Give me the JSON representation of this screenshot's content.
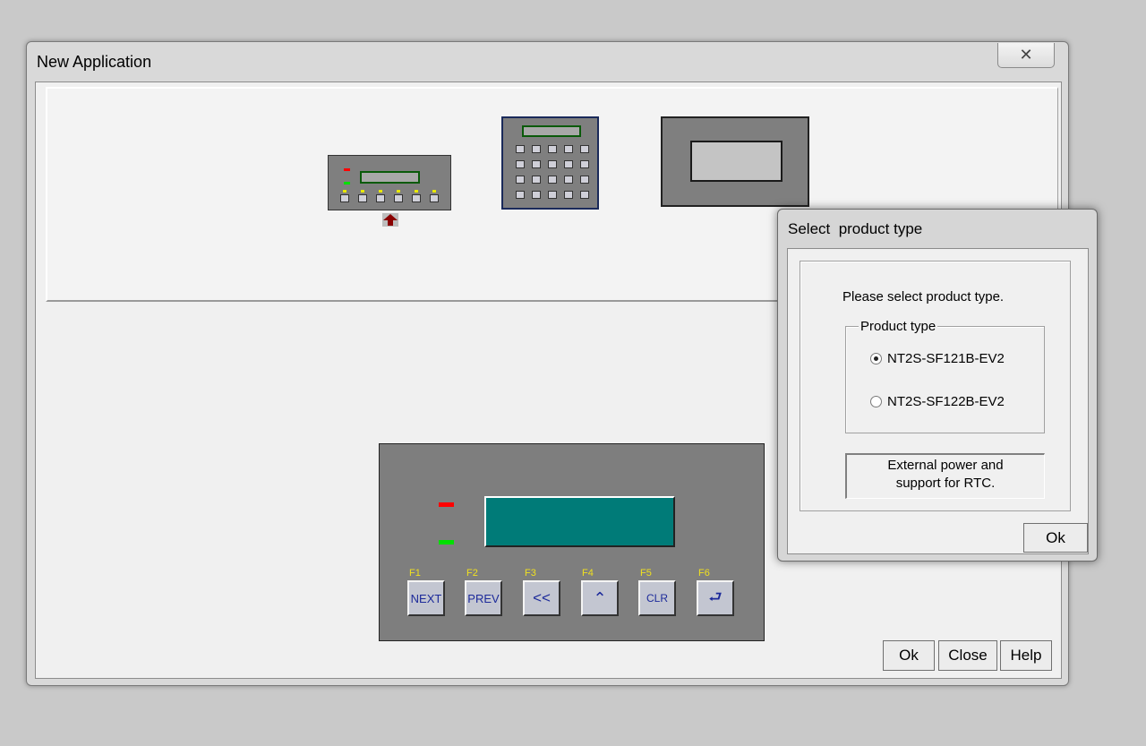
{
  "main_window": {
    "title": "New Application",
    "close_glyph": "✕",
    "buttons": {
      "ok": "Ok",
      "close": "Close",
      "help": "Help"
    }
  },
  "device_preview": {
    "led_colors": [
      "#ff0000",
      "#00e000"
    ],
    "lcd_color": "#007b78",
    "function_keys": [
      {
        "label": "F1",
        "key": "NEXT"
      },
      {
        "label": "F2",
        "key": "PREV"
      },
      {
        "label": "F3",
        "key": "<<"
      },
      {
        "label": "F4",
        "key": "⌃"
      },
      {
        "label": "F5",
        "key": "CLR"
      },
      {
        "label": "F6",
        "key": "⮐"
      }
    ]
  },
  "select_dialog": {
    "title": "Select  product type",
    "prompt": "Please select product type.",
    "group_label": "Product type",
    "options": [
      {
        "label": "NT2S-SF121B-EV2",
        "selected": true
      },
      {
        "label": "NT2S-SF122B-EV2",
        "selected": false
      }
    ],
    "description_line1": "External power and",
    "description_line2": "support for RTC.",
    "ok_label": "Ok"
  }
}
